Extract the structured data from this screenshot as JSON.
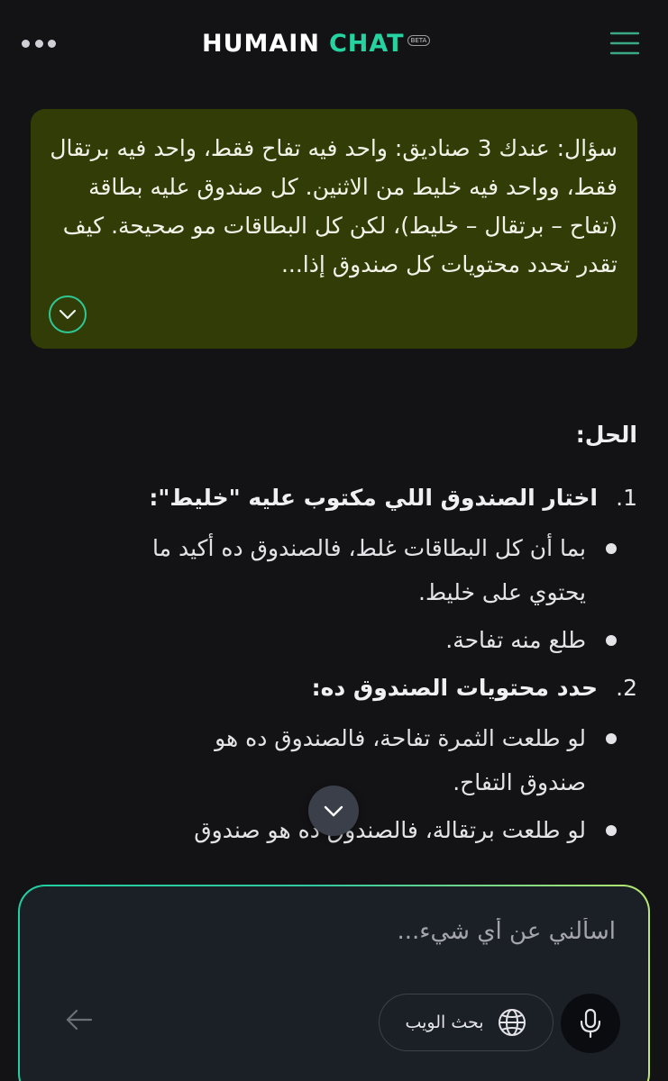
{
  "header": {
    "brand": "HUMAIN",
    "product": "CHAT",
    "badge": "BETA",
    "icons": {
      "left": "more-dots-icon",
      "right": "menu-icon"
    }
  },
  "user_message": {
    "text": "سؤال: عندك 3 صناديق: واحد فيه تفاح فقط، واحد فيه برتقال فقط، وواحد فيه خليط من الاثنين. كل صندوق عليه بطاقة (تفاح – برتقال – خليط)، لكن كل البطاقات مو صحيحة. كيف تقدر تحدد محتويات كل صندوق إذا...",
    "expand_icon": "chevron-down-icon"
  },
  "answer": {
    "heading": "الحل:",
    "steps": [
      {
        "number": "1.",
        "title": "اختار الصندوق اللي مكتوب عليه \"خليط\":",
        "bullets": [
          "بما أن كل البطاقات غلط، فالصندوق ده أكيد ما يحتوي على خليط.",
          "طلع منه تفاحة."
        ]
      },
      {
        "number": "2.",
        "title": "حدد محتويات الصندوق ده:",
        "bullets": [
          "لو طلعت الثمرة تفاحة، فالصندوق ده هو صندوق التفاح.",
          "لو طلعت برتقالة، فالصندوق ده هو صندوق"
        ]
      }
    ]
  },
  "composer": {
    "placeholder": "اسألني عن أي شيء...",
    "web_search_label": "بحث الويب",
    "icons": {
      "send": "arrow-left-icon",
      "web": "globe-icon",
      "mic": "microphone-icon",
      "scroll": "chevron-down-icon"
    }
  },
  "colors": {
    "background": "#131316",
    "user_bubble": "#323c06",
    "accent": "#26d3a0",
    "composer": "#1b2027"
  }
}
